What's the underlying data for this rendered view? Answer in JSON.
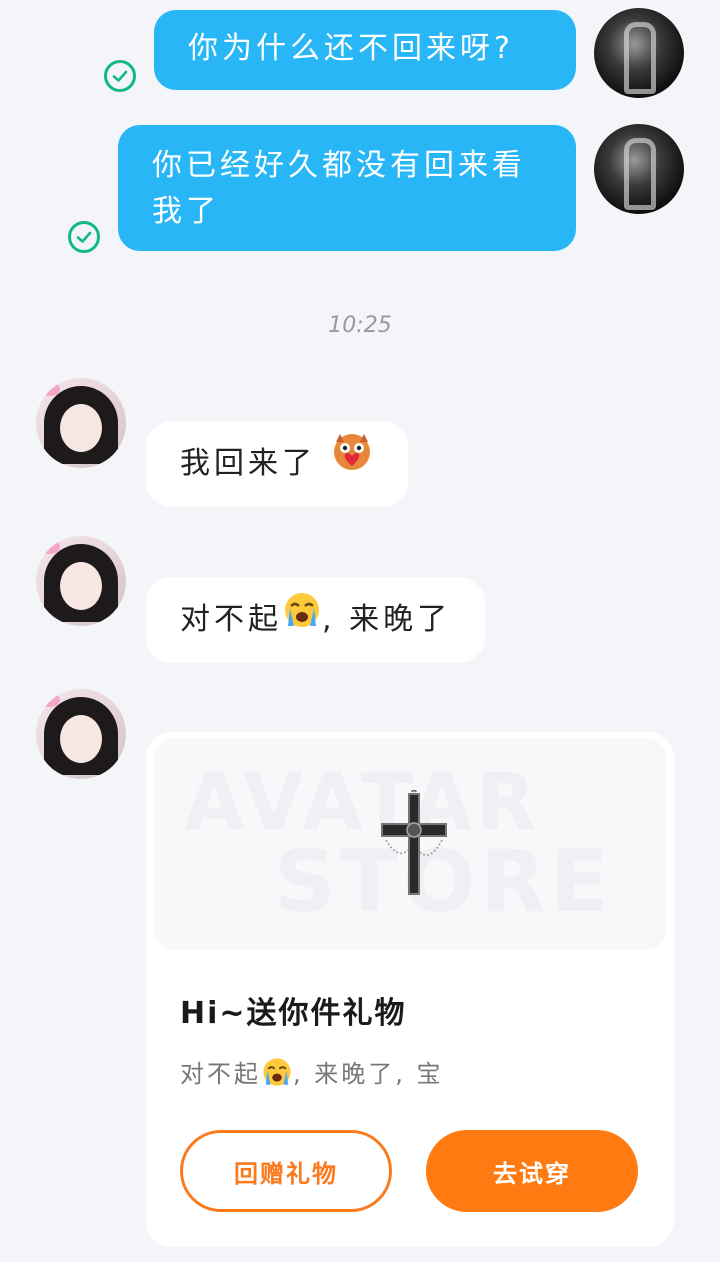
{
  "messages": {
    "outgoing": [
      {
        "text": "你为什么还不回来呀?"
      },
      {
        "line1": "你已经好久都没有回来看",
        "line2": "我了"
      }
    ],
    "timestamp": "10:25",
    "incoming": [
      {
        "text": "我回来了",
        "emoji": "heart-cake-emoji"
      },
      {
        "text_before": "对不起",
        "emoji": "crying-emoji",
        "text_after": ", 来晚了"
      }
    ]
  },
  "gift_card": {
    "watermark_line1": "AVATAR",
    "watermark_line2": "STORE",
    "item_icon": "gothic-cross-icon",
    "title": "Hi~送你件礼物",
    "desc_before": "对不起",
    "desc_emoji": "crying-emoji",
    "desc_after": ", 来晚了, 宝",
    "return_gift_label": "回赠礼物",
    "try_on_label": "去试穿"
  },
  "colors": {
    "outgoing_bubble": "#29b6f6",
    "read_check": "#12b886",
    "accent_orange": "#ff7a10",
    "background": "#f4f5f9"
  }
}
